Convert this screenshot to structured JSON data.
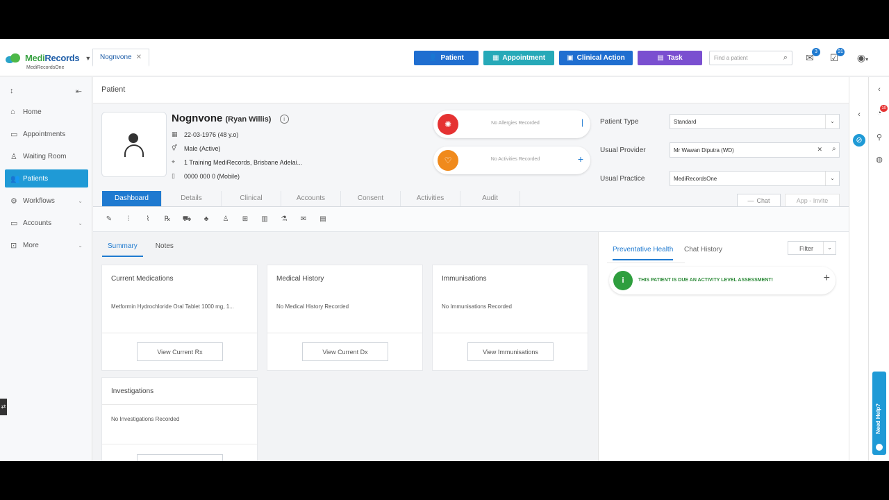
{
  "header": {
    "brand_a": "Medi",
    "brand_b": "Records",
    "brand_sub": "MediRecordsOne",
    "patient_tab": "Nognvone",
    "buttons": {
      "patient": "Patient",
      "appointment": "Appointment",
      "clinical_action": "Clinical Action",
      "task": "Task"
    },
    "button_colors": {
      "patient": "#1f6ed0",
      "appointment": "#26a9b8",
      "clinical_action": "#1f6ed0",
      "task": "#7a4fd0"
    },
    "find_placeholder": "Find a patient",
    "mail_badge": "3",
    "task_badge": "91"
  },
  "sidebar": {
    "items": [
      {
        "label": "Home",
        "icon": "home-icon"
      },
      {
        "label": "Appointments",
        "icon": "calendar-icon"
      },
      {
        "label": "Waiting Room",
        "icon": "waiting-icon"
      },
      {
        "label": "Patients",
        "icon": "patients-icon"
      },
      {
        "label": "Workflows",
        "icon": "workflow-icon"
      },
      {
        "label": "Accounts",
        "icon": "accounts-icon"
      },
      {
        "label": "More",
        "icon": "more-icon"
      }
    ]
  },
  "breadcrumb": "Patient",
  "patient": {
    "name": "Nognvone",
    "aka": "(Ryan Willis)",
    "dob": "22-03-1976 (48 y.o)",
    "sex": "Male (Active)",
    "address": "1 Training MediRecords, Brisbane Adelai...",
    "phone": "0000 000 0 (Mobile)"
  },
  "alerts": {
    "allergies": "No Allergies Recorded",
    "activities": "No Activities Recorded"
  },
  "fields": {
    "patient_type_label": "Patient Type",
    "patient_type": "Standard",
    "usual_provider_label": "Usual Provider",
    "usual_provider": "Mr Wawan Diputra (WD)",
    "usual_practice_label": "Usual Practice",
    "usual_practice": "MediRecordsOne"
  },
  "actions": {
    "chat": "Chat",
    "app_invite": "App - Invite"
  },
  "tabs": [
    "Dashboard",
    "Details",
    "Clinical",
    "Accounts",
    "Consent",
    "Activities",
    "Audit"
  ],
  "subtabs": [
    "Summary",
    "Notes"
  ],
  "cards": {
    "medications": {
      "title": "Current Medications",
      "value": "Metformin Hydrochloride Oral Tablet 1000 mg, 1...",
      "button": "View Current Rx"
    },
    "history": {
      "title": "Medical History",
      "value": "No Medical History Recorded",
      "button": "View Current Dx"
    },
    "immunisations": {
      "title": "Immunisations",
      "value": "No Immunisations Recorded",
      "button": "View Immunisations"
    },
    "investigations": {
      "title": "Investigations",
      "value": "No Investigations Recorded"
    }
  },
  "right_panel": {
    "tab_preventative": "Preventative Health",
    "tab_chat": "Chat History",
    "filter": "Filter",
    "due_text": "THIS PATIENT IS DUE AN ACTIVITY LEVEL ASSESSMENT!"
  },
  "notif_badge": "10",
  "help_text": "Need Help?"
}
